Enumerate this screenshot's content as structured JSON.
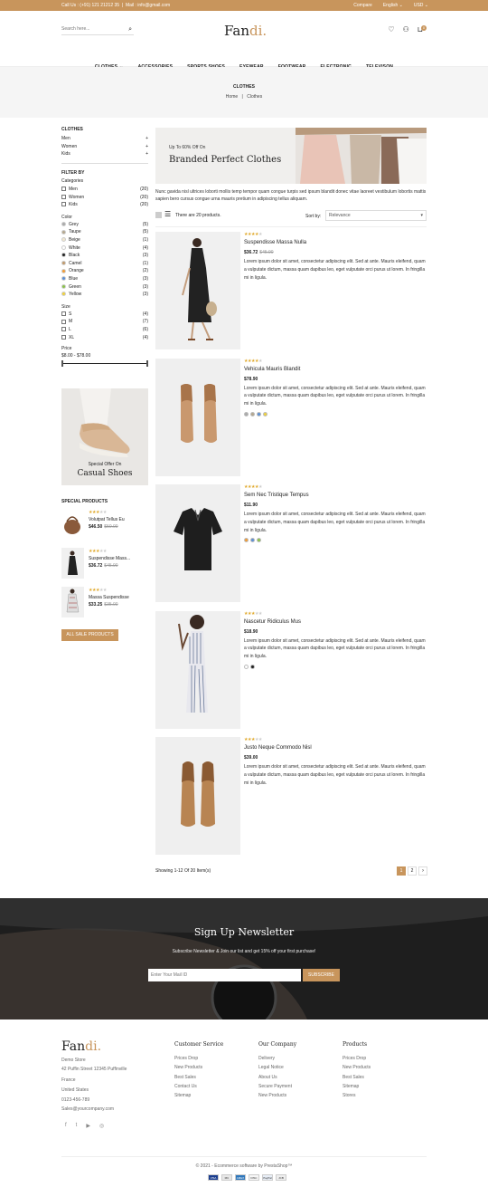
{
  "topbar": {
    "call": "Call Us : (+91) 121 21212 35",
    "mail": "Mail : info@gmail.com",
    "compare": "Compare",
    "language": "English",
    "currency": "USD"
  },
  "header": {
    "search_placeholder": "Search here...",
    "logo_main": "Fan",
    "logo_accent": "di.",
    "cart_count": "0"
  },
  "nav": [
    "CLOTHES",
    "ACCESSORIES",
    "SPORTS SHOES",
    "EYEWEAR",
    "FOOTWEAR",
    "ELECTRONIC",
    "TELEVISON"
  ],
  "breadcrumb": {
    "title": "CLOTHES",
    "home": "Home",
    "sep": "|",
    "current": "Clothes"
  },
  "sidebar": {
    "category_title": "CLOTHES",
    "categories": [
      {
        "label": "Men",
        "sign": "+"
      },
      {
        "label": "Women",
        "sign": "+"
      },
      {
        "label": "Kids",
        "sign": "+"
      }
    ],
    "filter_title": "FILTER BY",
    "categories_label": "Categories",
    "category_filters": [
      {
        "label": "Men",
        "count": "(20)"
      },
      {
        "label": "Women",
        "count": "(20)"
      },
      {
        "label": "Kids",
        "count": "(20)"
      }
    ],
    "color_label": "Color",
    "colors": [
      {
        "label": "Grey",
        "count": "(5)",
        "hex": "#aaaaaa"
      },
      {
        "label": "Taupe",
        "count": "(5)",
        "hex": "#b5a88f"
      },
      {
        "label": "Beige",
        "count": "(1)",
        "hex": "#f2e8d0"
      },
      {
        "label": "White",
        "count": "(4)",
        "hex": "#ffffff"
      },
      {
        "label": "Black",
        "count": "(3)",
        "hex": "#222222"
      },
      {
        "label": "Camel",
        "count": "(1)",
        "hex": "#c19a6b"
      },
      {
        "label": "Orange",
        "count": "(2)",
        "hex": "#f39c34"
      },
      {
        "label": "Blue",
        "count": "(3)",
        "hex": "#5a8fd6"
      },
      {
        "label": "Green",
        "count": "(3)",
        "hex": "#8bc34a"
      },
      {
        "label": "Yellow",
        "count": "(3)",
        "hex": "#f1d23c"
      }
    ],
    "size_label": "Size",
    "sizes": [
      {
        "label": "S",
        "count": "(4)"
      },
      {
        "label": "M",
        "count": "(7)"
      },
      {
        "label": "L",
        "count": "(6)"
      },
      {
        "label": "XL",
        "count": "(4)"
      }
    ],
    "price_label": "Price",
    "price_range": "$8.00 - $78.00",
    "promo_small": "Special Offer On",
    "promo_big": "Casual Shoes",
    "special_title": "SPECIAL PRODUCTS",
    "special": [
      {
        "name": "Volutpat Tellus Eu",
        "price": "$46.50",
        "old": "$50.00"
      },
      {
        "name": "Suspendisse Mass...",
        "price": "$36.72",
        "old": "$45.90"
      },
      {
        "name": "Massa Suspendisse",
        "price": "$33.25",
        "old": "$35.00"
      }
    ],
    "all_sale": "ALL SALE PRODUCTS"
  },
  "banner": {
    "small": "Up To 60% Off On",
    "big": "Branded Perfect Clothes"
  },
  "category_desc": "Nunc gavida nisl ultrices loborti mollis temp tempor quam congue turpis sed ipsum blandit donec vitae laoreet vestibulum lobortis mattis sapien bero cursus congue urna mauris pretium in adipiscing tellus aliquam.",
  "toolbar": {
    "count": "There are 20 products.",
    "sort_label": "Sort by:",
    "sort_value": "Relevance"
  },
  "products": [
    {
      "name": "Suspendisse Massa Nulla",
      "price": "$36.72",
      "old": "$45.90",
      "rating": 4,
      "desc": "Lorem ipsum dolor sit amet, consectetur adipiscing elit. Sed at ante. Mauris eleifend, quam a vulputate dictum, massa quam dapibus leo, eget vulputate orci purus ut lorem. In fringilla mi in ligula.",
      "colors": []
    },
    {
      "name": "Vehicula Mauris Blandit",
      "price": "$78.90",
      "old": "",
      "rating": 4,
      "desc": "Lorem ipsum dolor sit amet, consectetur adipiscing elit. Sed at ante. Mauris eleifend, quam a vulputate dictum, massa quam dapibus leo, eget vulputate orci purus ut lorem. In fringilla mi in ligula.",
      "colors": [
        "#aaaaaa",
        "#b5a88f",
        "#5a8fd6",
        "#f1d23c"
      ]
    },
    {
      "name": "Sem Nec Tristique Tempus",
      "price": "$11.90",
      "old": "",
      "rating": 4,
      "desc": "Lorem ipsum dolor sit amet, consectetur adipiscing elit. Sed at ante. Mauris eleifend, quam a vulputate dictum, massa quam dapibus leo, eget vulputate orci purus ut lorem. In fringilla mi in ligula.",
      "colors": [
        "#f39c34",
        "#5a8fd6",
        "#8bc34a"
      ]
    },
    {
      "name": "Nascetur Ridiculus Mus",
      "price": "$18.90",
      "old": "",
      "rating": 3,
      "desc": "Lorem ipsum dolor sit amet, consectetur adipiscing elit. Sed at ante. Mauris eleifend, quam a vulputate dictum, massa quam dapibus leo, eget vulputate orci purus ut lorem. In fringilla mi in ligula.",
      "colors": [
        "#ffffff",
        "#222222"
      ]
    },
    {
      "name": "Justo Neque Commodo Nisl",
      "price": "$39.00",
      "old": "",
      "rating": 3,
      "desc": "Lorem ipsum dolor sit amet, consectetur adipiscing elit. Sed at ante. Mauris eleifend, quam a vulputate dictum, massa quam dapibus leo, eget vulputate orci purus ut lorem. In fringilla mi in ligula.",
      "colors": []
    }
  ],
  "pagination": {
    "showing": "Showing 1-12 Of 20 Item(s)",
    "pages": [
      "1",
      "2"
    ],
    "next": "›"
  },
  "newsletter": {
    "title": "Sign Up Newsletter",
    "subtitle": "Subscribe Newsletter & Join our list and get 15% off your first purchase!",
    "placeholder": "Enter Your Mail ID",
    "button": "SUBSCRIBE"
  },
  "footer": {
    "logo_main": "Fan",
    "logo_accent": "di.",
    "store": [
      "Demo Store",
      "42 Puffin Street 12345 Puffinville",
      "France",
      "United States",
      "0123-456-789",
      "Sales@yourcompany.com"
    ],
    "customer_title": "Customer Service",
    "customer": [
      "Prices Drop",
      "New Products",
      "Best Sales",
      "Contact Us",
      "Sitemap"
    ],
    "company_title": "Our Company",
    "company": [
      "Delivery",
      "Legal Notice",
      "About Us",
      "Secure Payment",
      "New Products"
    ],
    "products_title": "Products",
    "products": [
      "Prices Drop",
      "New Products",
      "Best Sales",
      "Sitemap",
      "Stores"
    ],
    "social": [
      "f",
      "t",
      "▶",
      "◎"
    ],
    "copyright": "© 2021 - Ecommerce software by PrestaShop™",
    "payments": [
      "VISA",
      "MC",
      "AMEX",
      "DISC",
      "PayPal",
      "JCB"
    ]
  },
  "colors": {
    "accent": "#c8955c"
  }
}
